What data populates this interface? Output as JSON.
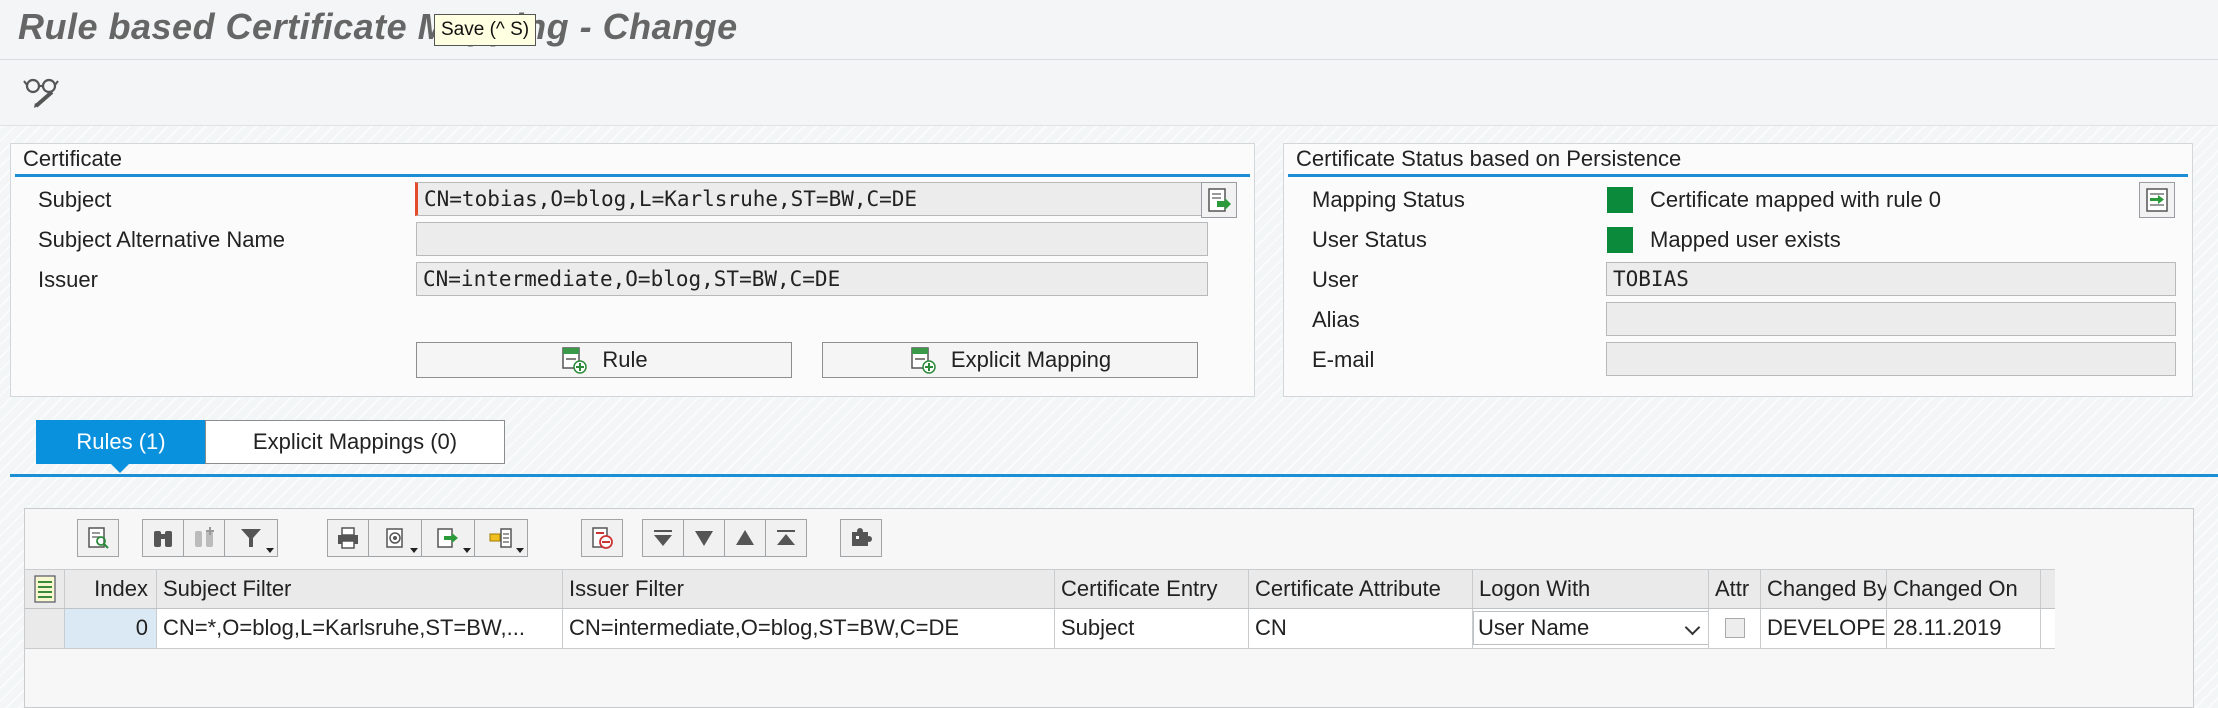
{
  "window": {
    "title": "Rule based Certificate Mapping - Change",
    "tooltip": "Save (^ S)"
  },
  "toolbar": {
    "display_change_icon": "glasses-pencil-icon"
  },
  "certificate": {
    "heading": "Certificate",
    "subject_label": "Subject",
    "subject_value": "CN=tobias,O=blog,L=Karlsruhe,ST=BW,C=DE",
    "san_label": "Subject Alternative Name",
    "san_value": "",
    "issuer_label": "Issuer",
    "issuer_value": "CN=intermediate,O=blog,ST=BW,C=DE",
    "rule_button": "Rule",
    "explicit_button": "Explicit Mapping"
  },
  "status": {
    "heading": "Certificate Status based on Persistence",
    "mapping_label": "Mapping Status",
    "mapping_value": "Certificate mapped with rule 0",
    "user_status_label": "User Status",
    "user_status_value": "Mapped user exists",
    "user_label": "User",
    "user_value": "TOBIAS",
    "alias_label": "Alias",
    "alias_value": "",
    "email_label": "E-mail",
    "email_value": "",
    "status_color": "#0b8a3b"
  },
  "tabs": [
    {
      "label": "Rules (1)",
      "active": true
    },
    {
      "label": "Explicit Mappings (0)",
      "active": false
    }
  ],
  "grid": {
    "columns": [
      "Index",
      "Subject Filter",
      "Issuer Filter",
      "Certificate Entry",
      "Certificate Attribute",
      "Logon With",
      "Attr",
      "Changed By",
      "Changed On"
    ],
    "rows": [
      {
        "index": "0",
        "subject_filter": "CN=*,O=blog,L=Karlsruhe,ST=BW,...",
        "issuer_filter": "CN=intermediate,O=blog,ST=BW,C=DE",
        "certificate_entry": "Subject",
        "certificate_attribute": "CN",
        "logon_with": "User Name",
        "attr": false,
        "changed_by": "DEVELOPER",
        "changed_on": "28.11.2019"
      }
    ]
  },
  "colors": {
    "accent": "#1a8fd6",
    "active_tab": "#0a91de",
    "status_green": "#0b8a3b"
  }
}
